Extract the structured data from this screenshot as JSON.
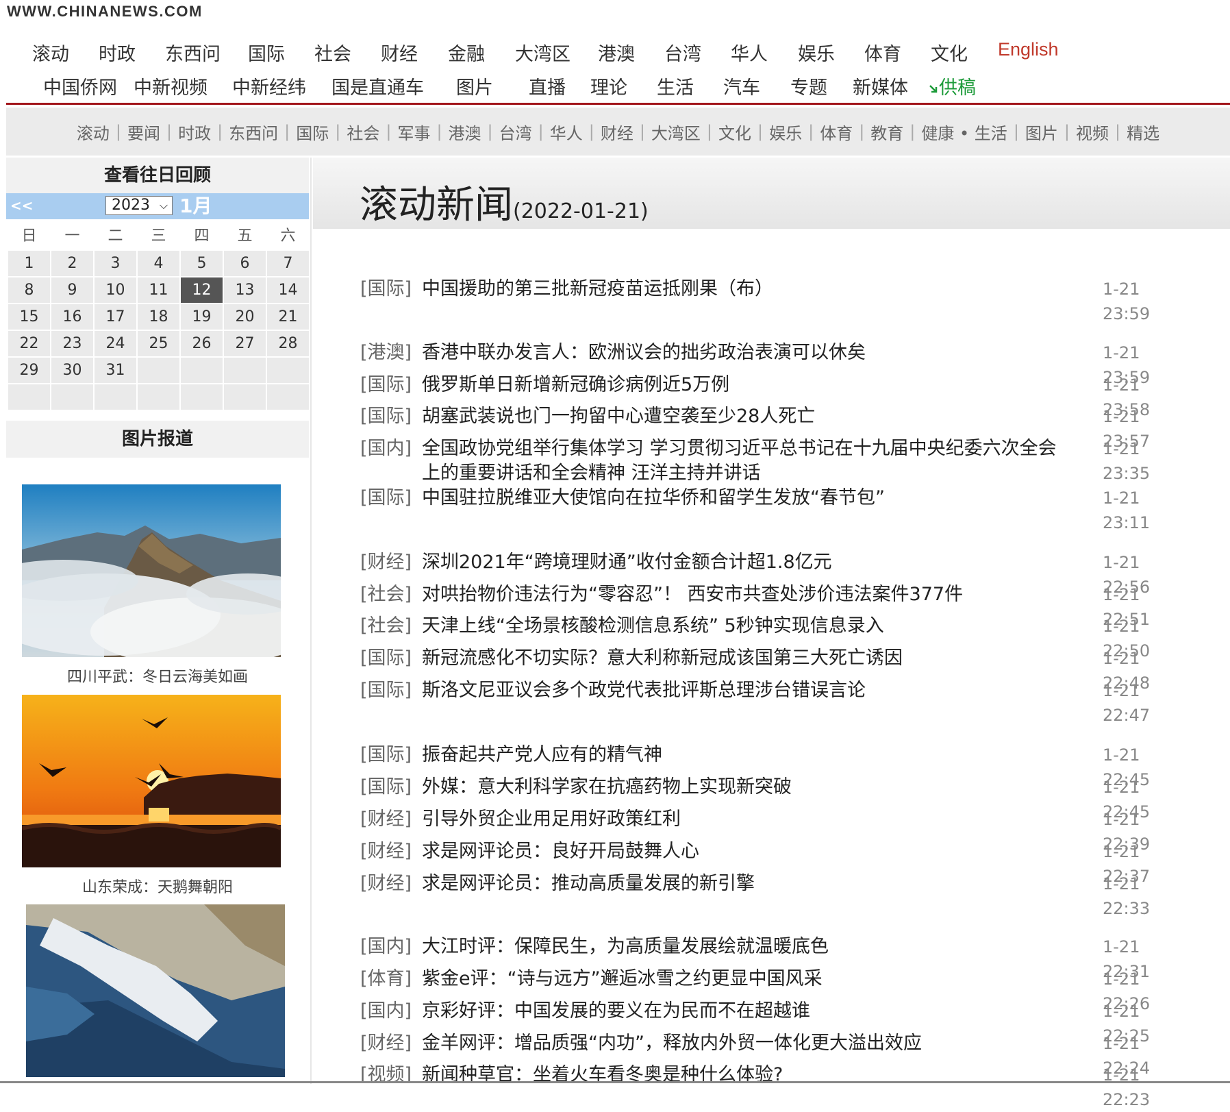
{
  "site": {
    "logo": "WWW.CHINANEWS.COM"
  },
  "nav": {
    "row1": [
      "滚动",
      "时政",
      "东西问",
      "国际",
      "社会",
      "财经",
      "金融",
      "大湾区",
      "港澳",
      "台湾",
      "华人",
      "娱乐",
      "体育",
      "文化",
      "English"
    ],
    "row2": [
      "中国侨网",
      "中新视频",
      "中新经纬",
      "国是直通车",
      "图片",
      "直播",
      "理论",
      "生活",
      "汽车",
      "专题",
      "新媒体",
      "供稿"
    ],
    "submit_icon": "arrow-down-right-icon"
  },
  "subnav": [
    "滚动",
    "要闻",
    "时政",
    "东西问",
    "国际",
    "社会",
    "军事",
    "港澳",
    "台湾",
    "华人",
    "财经",
    "大湾区",
    "文化",
    "娱乐",
    "体育",
    "教育",
    "健康 • 生活",
    "图片",
    "视频",
    "精选"
  ],
  "calendar": {
    "title": "查看往日回顾",
    "prev": "<<",
    "year": "2023",
    "month": "1月",
    "weekdays": [
      "日",
      "一",
      "二",
      "三",
      "四",
      "五",
      "六"
    ],
    "days": [
      "1",
      "2",
      "3",
      "4",
      "5",
      "6",
      "7",
      "8",
      "9",
      "10",
      "11",
      "12",
      "13",
      "14",
      "15",
      "16",
      "17",
      "18",
      "19",
      "20",
      "21",
      "22",
      "23",
      "24",
      "25",
      "26",
      "27",
      "28",
      "29",
      "30",
      "31"
    ],
    "today": "12"
  },
  "photos": {
    "title": "图片报道",
    "items": [
      {
        "caption": "四川平武：冬日云海美如画"
      },
      {
        "caption": "山东荣成：天鹅舞朝阳"
      },
      {
        "caption": ""
      }
    ]
  },
  "main": {
    "title": "滚动新闻",
    "date": "(2022-01-21)"
  },
  "news": [
    {
      "cat": "[国际]",
      "title": "中国援助的第三批新冠疫苗运抵刚果（布）",
      "time": "1-21 23:59"
    },
    {
      "cat": "[港澳]",
      "title": "香港中联办发言人：欧洲议会的拙劣政治表演可以休矣",
      "time": "1-21 23:59"
    },
    {
      "cat": "[国际]",
      "title": "俄罗斯单日新增新冠确诊病例近5万例",
      "time": "1-21 23:58"
    },
    {
      "cat": "[国际]",
      "title": "胡塞武装说也门一拘留中心遭空袭至少28人死亡",
      "time": "1-21 23:57"
    },
    {
      "cat": "[国内]",
      "title": "全国政协党组举行集体学习 学习贯彻习近平总书记在十九届中央纪委六次全会上的重要讲话和全会精神 汪洋主持并讲话",
      "time": "1-21 23:35"
    },
    {
      "cat": "[国际]",
      "title": "中国驻拉脱维亚大使馆向在拉华侨和留学生发放“春节包”",
      "time": "1-21 23:11"
    },
    {
      "cat": "[财经]",
      "title": "深圳2021年“跨境理财通”收付金额合计超1.8亿元",
      "time": "1-21 22:56"
    },
    {
      "cat": "[社会]",
      "title": "对哄抬物价违法行为“零容忍”！ 西安市共查处涉价违法案件377件",
      "time": "1-21 22:51"
    },
    {
      "cat": "[社会]",
      "title": "天津上线“全场景核酸检测信息系统” 5秒钟实现信息录入",
      "time": "1-21 22:50"
    },
    {
      "cat": "[国际]",
      "title": "新冠流感化不切实际？意大利称新冠成该国第三大死亡诱因",
      "time": "1-21 22:48"
    },
    {
      "cat": "[国际]",
      "title": "斯洛文尼亚议会多个政党代表批评斯总理涉台错误言论",
      "time": "1-21 22:47"
    },
    {
      "cat": "[国际]",
      "title": "振奋起共产党人应有的精气神",
      "time": "1-21 22:45"
    },
    {
      "cat": "[国际]",
      "title": "外媒：意大利科学家在抗癌药物上实现新突破",
      "time": "1-21 22:45"
    },
    {
      "cat": "[财经]",
      "title": "引导外贸企业用足用好政策红利",
      "time": "1-21 22:39"
    },
    {
      "cat": "[财经]",
      "title": "求是网评论员：良好开局鼓舞人心",
      "time": "1-21 22:37"
    },
    {
      "cat": "[财经]",
      "title": "求是网评论员：推动高质量发展的新引擎",
      "time": "1-21 22:33"
    },
    {
      "cat": "[国内]",
      "title": "大江时评：保障民生，为高质量发展绘就温暖底色",
      "time": "1-21 22:31"
    },
    {
      "cat": "[体育]",
      "title": "紫金e评：“诗与远方”邂逅冰雪之约更显中国风采",
      "time": "1-21 22:26"
    },
    {
      "cat": "[国内]",
      "title": "京彩好评：中国发展的要义在为民而不在超越谁",
      "time": "1-21 22:25"
    },
    {
      "cat": "[财经]",
      "title": "金羊网评：增品质强“内功”，释放内外贸一体化更大溢出效应",
      "time": "1-21 22:24"
    },
    {
      "cat": "[视频]",
      "title": "新闻种草官：坐着火车看冬奥是种什么体验?",
      "time": "1-21 22:23"
    }
  ]
}
